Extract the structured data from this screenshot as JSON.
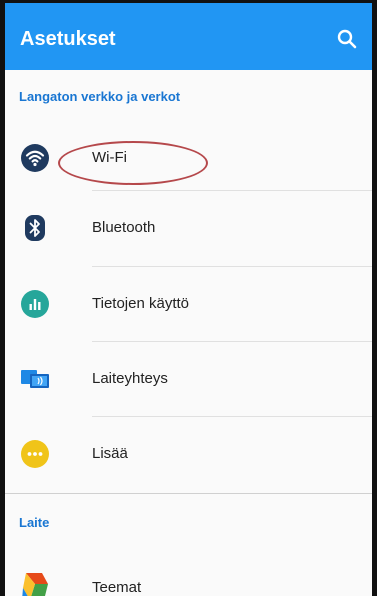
{
  "appbar": {
    "title": "Asetukset",
    "search_icon": "search-icon"
  },
  "sections": [
    {
      "header": "Langaton verkko ja verkot",
      "items": [
        {
          "label": "Wi-Fi",
          "icon": "wifi-icon",
          "color": "#1f3a5f"
        },
        {
          "label": "Bluetooth",
          "icon": "bluetooth-icon",
          "color": "#1f3a5f"
        },
        {
          "label": "Tietojen käyttö",
          "icon": "data-usage-icon",
          "color": "#26a69a"
        },
        {
          "label": "Laiteyhteys",
          "icon": "device-connection-icon",
          "color": "#1e88e5"
        },
        {
          "label": "Lisää",
          "icon": "more-icon",
          "color": "#f0c419"
        }
      ]
    },
    {
      "header": "Laite",
      "items": [
        {
          "label": "Teemat",
          "icon": "themes-icon",
          "color": "#e64a19"
        }
      ]
    }
  ],
  "colors": {
    "accent": "#2196F3",
    "section_header": "#1976D2",
    "annotation_ellipse": "#b5484b"
  }
}
